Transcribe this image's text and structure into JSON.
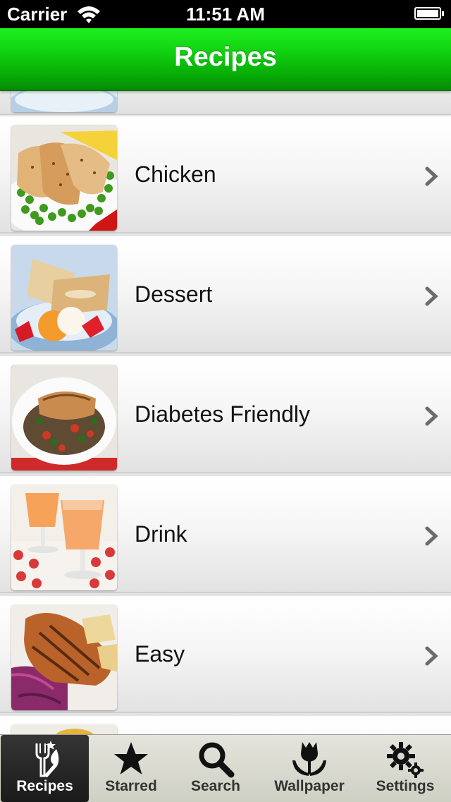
{
  "status_bar": {
    "carrier": "Carrier",
    "time": "11:51 AM"
  },
  "nav": {
    "title": "Recipes"
  },
  "list": {
    "items": [
      {
        "label": "Chicken",
        "icon": "chevron-right-icon"
      },
      {
        "label": "Dessert",
        "icon": "chevron-right-icon"
      },
      {
        "label": "Diabetes Friendly",
        "icon": "chevron-right-icon"
      },
      {
        "label": "Drink",
        "icon": "chevron-right-icon"
      },
      {
        "label": "Easy",
        "icon": "chevron-right-icon"
      }
    ]
  },
  "tabs": [
    {
      "label": "Recipes",
      "icon": "fork-knife-star-icon",
      "active": true
    },
    {
      "label": "Starred",
      "icon": "star-icon",
      "active": false
    },
    {
      "label": "Search",
      "icon": "magnifier-icon",
      "active": false
    },
    {
      "label": "Wallpaper",
      "icon": "tulip-icon",
      "active": false
    },
    {
      "label": "Settings",
      "icon": "gears-icon",
      "active": false
    }
  ],
  "colors": {
    "nav_green": "#10d010",
    "tab_active": "#1a1a1a"
  }
}
